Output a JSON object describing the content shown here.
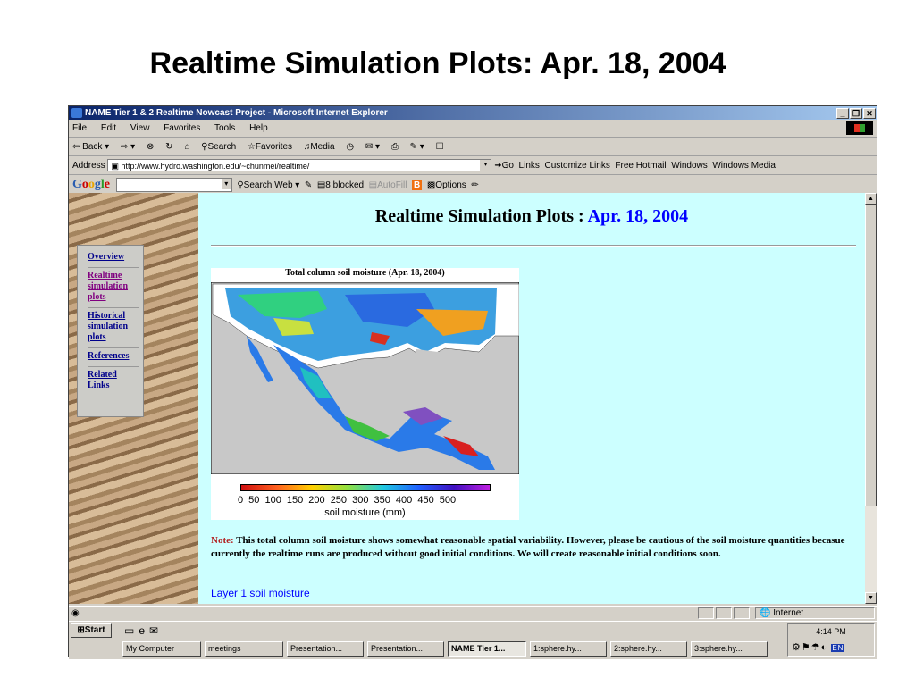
{
  "slide": {
    "title": "Realtime Simulation Plots: Apr. 18, 2004"
  },
  "window": {
    "title": "NAME Tier 1 & 2 Realtime Nowcast Project - Microsoft Internet Explorer"
  },
  "menu": [
    "File",
    "Edit",
    "View",
    "Favorites",
    "Tools",
    "Help"
  ],
  "toolbar": {
    "back": "Back",
    "search": "Search",
    "favorites": "Favorites",
    "media": "Media"
  },
  "address": {
    "label": "Address",
    "url": "http://www.hydro.washington.edu/~chunmei/realtime/",
    "go": "Go",
    "links_label": "Links",
    "links": [
      "Customize Links",
      "Free Hotmail",
      "Windows",
      "Windows Media"
    ]
  },
  "googlebar": {
    "logo": "Google",
    "search_web": "Search Web",
    "blocked": "8 blocked",
    "autofill": "AutoFill",
    "options": "Options"
  },
  "sidebar": {
    "items": [
      {
        "label": "Overview"
      },
      {
        "label": "Realtime simulation plots",
        "visited": true
      },
      {
        "label": "Historical simulation plots"
      },
      {
        "label": "References"
      },
      {
        "label": "Related Links"
      }
    ]
  },
  "page": {
    "title_prefix": "Realtime Simulation Plots :",
    "title_date": "Apr. 18, 2004",
    "note_label": "Note:",
    "note_text": "This total column soil moisture shows somewhat reasonable spatial variability. However, please be cautious of the soil moisture quantities becasue currently the realtime runs are produced without good initial conditions. We will create reasonable initial conditions soon.",
    "layer_link": "Layer 1 soil moisture"
  },
  "figure": {
    "title": "Total column soil moisture (Apr. 18, 2004)",
    "colorbar_ticks": "0 50 100 150 200 250 300 350 400 450 500",
    "colorbar_label": "soil moisture (mm)"
  },
  "status": {
    "zone": "Internet"
  },
  "taskbar": {
    "start": "Start",
    "tasks": [
      "My Computer",
      "meetings",
      "Presentation...",
      "Presentation...",
      "NAME Tier 1...",
      "1:sphere.hy...",
      "2:sphere.hy...",
      "3:sphere.hy..."
    ],
    "clock": "4:14 PM",
    "lang": "EN"
  },
  "colors": {
    "page_bg": "#ccffff",
    "title_bar": "#0a246a",
    "link": "#0000ff",
    "date": "#0000ff"
  }
}
